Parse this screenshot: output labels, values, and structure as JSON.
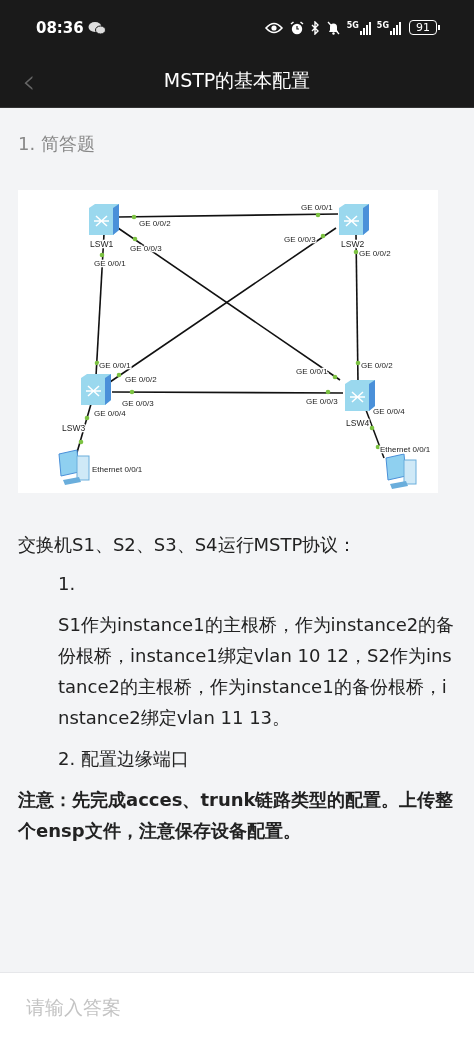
{
  "status_bar": {
    "time": "08:36",
    "networks": [
      "5G",
      "5G"
    ],
    "battery": "91"
  },
  "header": {
    "back": "‹",
    "title": "MSTP的基本配置"
  },
  "question": {
    "number": "1. 简答题",
    "diagram": {
      "nodes": [
        {
          "kind": "switch",
          "label": "LSW1"
        },
        {
          "kind": "switch",
          "label": "LSW2"
        },
        {
          "kind": "switch",
          "label": "LSW3"
        },
        {
          "kind": "switch",
          "label": "LSW4"
        },
        {
          "kind": "pc"
        },
        {
          "kind": "pc"
        }
      ],
      "links": [
        {
          "ports": [
            "GE 0/0/2",
            "GE 0/0/1"
          ]
        },
        {
          "ports": [
            "GE 0/0/1",
            "GE 0/0/1"
          ]
        },
        {
          "ports": [
            "GE 0/0/3",
            "GE 0/0/1"
          ]
        },
        {
          "ports": [
            "GE 0/0/3",
            "GE 0/0/2"
          ]
        },
        {
          "ports": [
            "GE 0/0/2",
            "GE 0/0/2"
          ]
        },
        {
          "ports": [
            "GE 0/0/3",
            "GE 0/0/3"
          ]
        },
        {
          "ports": [
            "GE 0/0/4",
            "Ethernet 0/0/1"
          ]
        },
        {
          "ports": [
            "GE 0/0/4",
            "Ethernet 0/0/1"
          ]
        }
      ]
    },
    "intro": "交换机S1、S2、S3、S4运行MSTP协议：",
    "items": [
      {
        "marker": "1."
      },
      {
        "marker": "",
        "text": "S1作为instance1的主根桥，作为instance2的备份根桥，instance1绑定vlan 10 12，S2作为instance2的主根桥，作为instance1的备份根桥，instance2绑定vlan 11 13。"
      },
      {
        "marker": "2.",
        "text": "配置边缘端口"
      }
    ],
    "note": "注意：先完成acces、trunk链路类型的配置。上传整个ensp文件，注意保存设备配置。"
  },
  "answer": {
    "placeholder": "请输入答案"
  }
}
